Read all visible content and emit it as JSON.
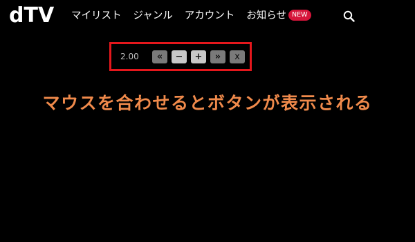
{
  "header": {
    "logo_text": "dTV",
    "nav": [
      {
        "label": "マイリスト"
      },
      {
        "label": "ジャンル"
      },
      {
        "label": "アカウント"
      },
      {
        "label": "お知らせ"
      }
    ],
    "badge": "NEW",
    "search_icon": "search-icon"
  },
  "player_controls": {
    "speed_value": "2.00",
    "buttons": {
      "rewind": "«",
      "decrease": "−",
      "increase": "+",
      "forward": "»",
      "close": "x"
    },
    "highlight_color": "#e5171c"
  },
  "caption": {
    "text": "マウスを合わせるとボタンが表示される",
    "color": "#f08a4b"
  }
}
